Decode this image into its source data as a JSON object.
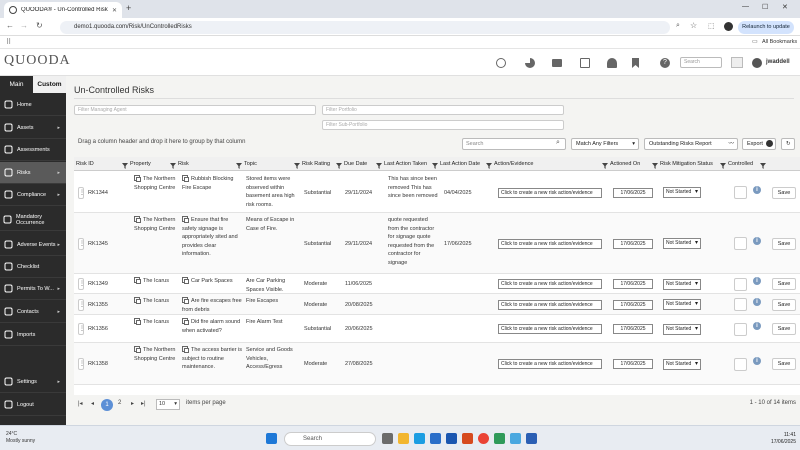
{
  "browser": {
    "tab_title": "QUOODA® - Un-Controlled Risks",
    "url": "demo1.quooda.com/Risk/UnControlledRisks",
    "relaunch_label": "Relaunch to update",
    "all_bookmarks": "All Bookmarks"
  },
  "header": {
    "logo_text": "QUOODA",
    "search_placeholder": "Search",
    "username": "jwaddell"
  },
  "sidebar": {
    "tab_main": "Main",
    "tab_custom": "Custom",
    "items": [
      {
        "label": "Home",
        "icon": "home-icon",
        "arrow": false
      },
      {
        "label": "Assets",
        "icon": "assets-icon",
        "arrow": true
      },
      {
        "label": "Assessments",
        "icon": "assessments-icon",
        "arrow": false
      },
      {
        "label": "Risks",
        "icon": "risks-icon",
        "arrow": true
      },
      {
        "label": "Compliance",
        "icon": "compliance-icon",
        "arrow": true
      },
      {
        "label": "Mandatory Occurrence",
        "icon": "occurrence-icon",
        "arrow": false
      },
      {
        "label": "Adverse Events",
        "icon": "adverse-events-icon",
        "arrow": true
      },
      {
        "label": "Checklist",
        "icon": "checklist-icon",
        "arrow": false
      },
      {
        "label": "Permits To W...",
        "icon": "permits-icon",
        "arrow": true
      },
      {
        "label": "Contacts",
        "icon": "contacts-icon",
        "arrow": true
      },
      {
        "label": "Imports",
        "icon": "imports-icon",
        "arrow": false
      },
      {
        "label": "Settings",
        "icon": "settings-icon",
        "arrow": true
      },
      {
        "label": "Logout",
        "icon": "logout-icon",
        "arrow": false
      }
    ]
  },
  "page": {
    "title": "Un-Controlled Risks",
    "filter_managing_agent": "Filter Managing Agent",
    "filter_portfolio": "Filter Portfolio",
    "filter_sub_portfolio": "Filter Sub-Portfolio",
    "drag_hint": "Drag a column header and drop it here to group by that column",
    "grid_search_placeholder": "Search",
    "match_filter": "Match Any Filters",
    "outstanding_report": "Outstanding Risks Report",
    "export": "Export"
  },
  "table": {
    "headers": [
      "Risk ID",
      "Property",
      "Risk",
      "Topic",
      "Risk Rating",
      "Due Date",
      "Last Action Taken",
      "Last Action Date",
      "Action/Evidence",
      "Actioned On",
      "Risk Mitigation Status",
      "Controlled"
    ],
    "action_placeholder": "Click to create a new risk action/evidence",
    "save_label": "Save",
    "rows": [
      {
        "id": "RK1344",
        "property": "The Northern Shopping Centre",
        "risk": "Rubbish Blocking Fire Escape",
        "topic": "Stored items were observed within basement area high risk rooms.",
        "rating": "Substantial",
        "due": "29/11/2024",
        "last_action": "This has since been removed This has since been removed",
        "last_date": "04/04/2025",
        "actioned_on": "17/06/2025",
        "status": "Not Started"
      },
      {
        "id": "RK1345",
        "property": "The Northern Shopping Centre",
        "risk": "Ensure that fire safety signage is appropriately sited and provides clear information.",
        "topic": "Means of Escape in Case of Fire.",
        "rating": "Substantial",
        "due": "29/11/2024",
        "last_action": "quote requested from the contractor for signage quote requested from the contractor for signage",
        "last_date": "17/06/2025",
        "actioned_on": "17/06/2025",
        "status": "Not Started"
      },
      {
        "id": "RK1349",
        "property": "The Icarus",
        "risk": "Car Park Spaces",
        "topic": "Are Car Parking Spaces Visible.",
        "rating": "Moderate",
        "due": "11/06/2025",
        "last_action": "",
        "last_date": "",
        "actioned_on": "17/06/2025",
        "status": "Not Started"
      },
      {
        "id": "RK1355",
        "property": "The Icarus",
        "risk": "Are fire escapes free from debris",
        "topic": "Fire Escapes",
        "rating": "Moderate",
        "due": "20/08/2025",
        "last_action": "",
        "last_date": "",
        "actioned_on": "17/06/2025",
        "status": "Not Started"
      },
      {
        "id": "RK1356",
        "property": "The Icarus",
        "risk": "Did fire alarm sound when activated?",
        "topic": "Fire Alarm Test",
        "rating": "Substantial",
        "due": "20/06/2025",
        "last_action": "",
        "last_date": "",
        "actioned_on": "17/06/2025",
        "status": "Not Started"
      },
      {
        "id": "RK1358",
        "property": "The Northern Shopping Centre",
        "risk": "The access barrier is subject to routine maintenance.",
        "topic": "Service and Goods Vehicles, Access/Egress",
        "rating": "Moderate",
        "due": "27/08/2025",
        "last_action": "",
        "last_date": "",
        "actioned_on": "17/06/2025",
        "status": "Not Started"
      }
    ]
  },
  "pager": {
    "current_page": "1",
    "page2": "2",
    "page_size": "10",
    "items_per_page": "items per page",
    "summary": "1 - 10 of 14 items"
  },
  "taskbar": {
    "temperature": "24°C",
    "weather": "Mostly sunny",
    "search": "Search",
    "time": "11:41",
    "date": "17/06/2025"
  },
  "colors": {
    "sidebar_bg": "#2b2b2b",
    "accent": "#5c8fd6",
    "info": "#7a9abf"
  }
}
